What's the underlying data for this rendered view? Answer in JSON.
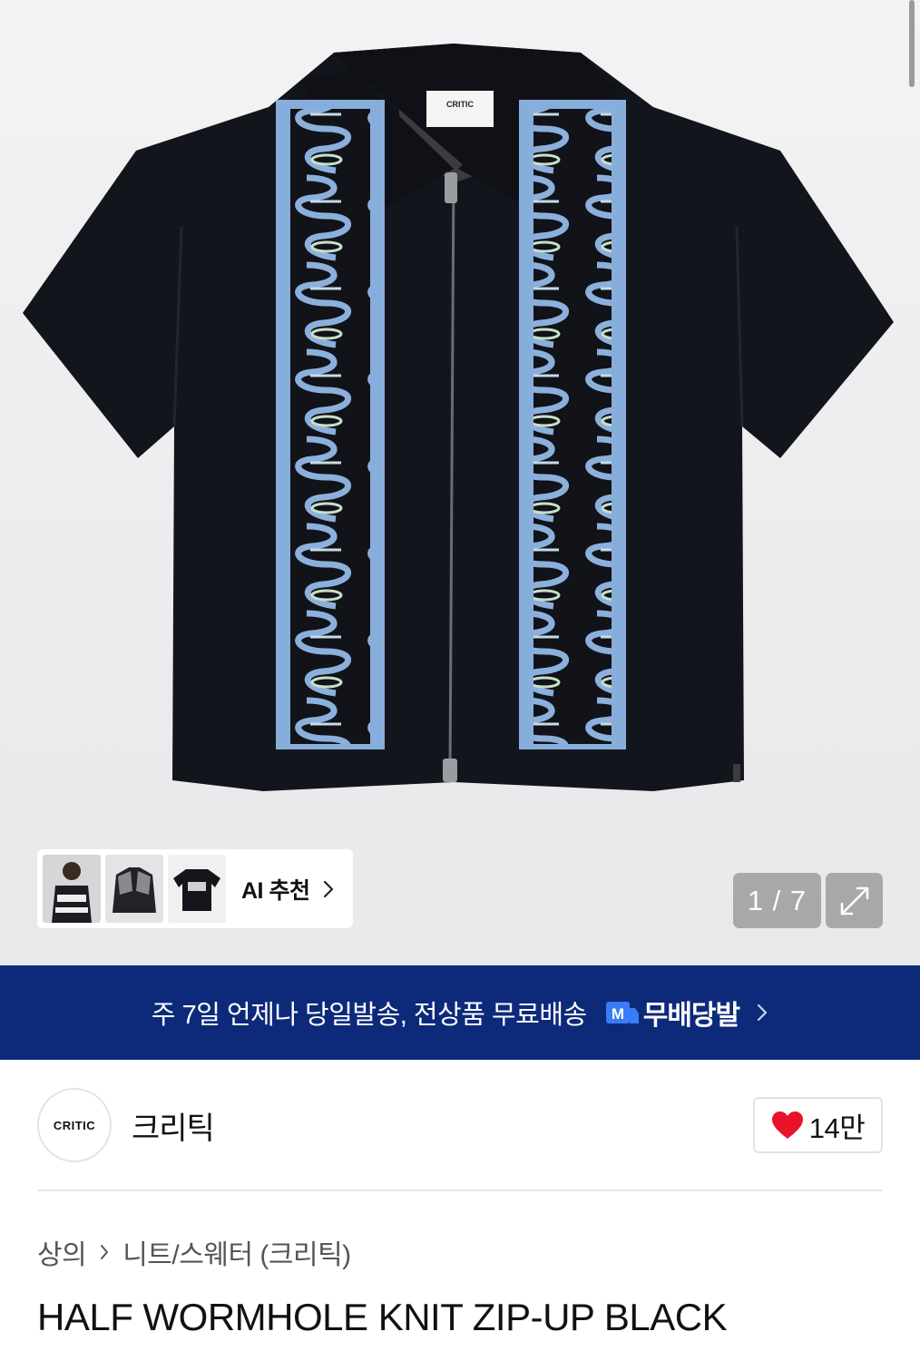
{
  "ai_recommend": {
    "label": "AI 추천",
    "thumbnails": [
      "model-photo",
      "bomber-jacket",
      "graphic-tee"
    ]
  },
  "gallery": {
    "counter": "1 / 7"
  },
  "banner": {
    "text": "주 7일 언제나 당일발송, 전상품 무료배송",
    "badge": "M",
    "brand": "무배당발"
  },
  "brand": {
    "logo_text": "CRITIC",
    "name": "크리틱",
    "likes": "14만"
  },
  "breadcrumb": {
    "items": [
      "상의",
      "니트/스웨터 (크리틱)"
    ]
  },
  "product": {
    "title": "HALF WORMHOLE KNIT ZIP-UP BLACK",
    "label_text": "CRITIC"
  },
  "colors": {
    "banner_bg": "#0d2a7a",
    "heart": "#e8132a",
    "garment": "#13151c",
    "stripe_blue": "#87aedb"
  }
}
